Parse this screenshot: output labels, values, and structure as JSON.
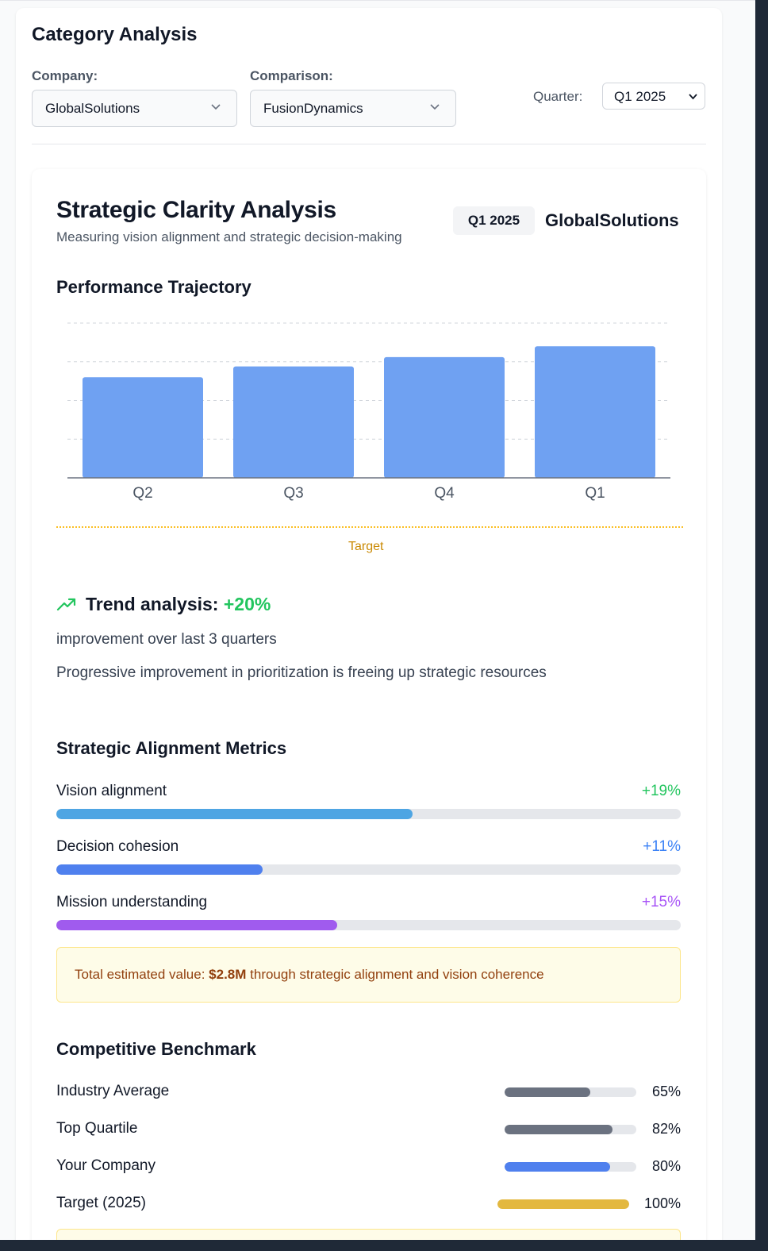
{
  "header": {
    "title": "Category Analysis"
  },
  "filters": {
    "company_label": "Company:",
    "company_value": "GlobalSolutions",
    "comparison_label": "Comparison:",
    "comparison_value": "FusionDynamics",
    "quarter_label": "Quarter:",
    "quarter_value": "Q1 2025"
  },
  "card": {
    "title": "Strategic Clarity Analysis",
    "subtitle": "Measuring vision alignment and strategic decision-making",
    "quarter_badge": "Q1 2025",
    "company": "GlobalSolutions"
  },
  "trajectory": {
    "title": "Performance Trajectory",
    "target_label": "Target"
  },
  "chart_data": {
    "type": "bar",
    "categories": [
      "Q2",
      "Q3",
      "Q4",
      "Q1"
    ],
    "values": [
      65,
      72,
      78,
      85
    ],
    "title": "",
    "xlabel": "",
    "ylabel": "",
    "ylim": [
      0,
      100
    ],
    "grid": true,
    "colors": {
      "bar": "#6fa1f2",
      "grid": "#d1d5db",
      "axis": "#6b7280"
    }
  },
  "trend": {
    "label": "Trend analysis:",
    "value": "+20%",
    "line1": "improvement over last 3 quarters",
    "line2": "Progressive improvement in prioritization is freeing up strategic resources",
    "icon": "trending-up-icon"
  },
  "metrics": {
    "title": "Strategic Alignment Metrics",
    "items": [
      {
        "label": "Vision alignment",
        "value": "+19%",
        "fill": 0.57,
        "color": "#4ea5e3"
      },
      {
        "label": "Decision cohesion",
        "value": "+11%",
        "fill": 0.33,
        "color": "#4f80ee"
      },
      {
        "label": "Mission understanding",
        "value": "+15%",
        "fill": 0.45,
        "color": "#a05bee"
      }
    ],
    "value_colors": [
      "#22c55e",
      "#3b82f6",
      "#a855f7"
    ]
  },
  "value_box": {
    "prefix": "Total estimated value:",
    "amount": "$2.8M",
    "suffix": "through strategic alignment and vision coherence"
  },
  "benchmark": {
    "title": "Competitive Benchmark",
    "items": [
      {
        "label": "Industry Average",
        "value": "65%",
        "fill": 0.65,
        "color": "#6b7280"
      },
      {
        "label": "Top Quartile",
        "value": "82%",
        "fill": 0.82,
        "color": "#6b7280"
      },
      {
        "label": "Your Company",
        "value": "80%",
        "fill": 0.8,
        "color": "#4f80ee"
      },
      {
        "label": "Target (2025)",
        "value": "100%",
        "fill": 1.0,
        "color": "#e3b83f"
      }
    ]
  }
}
